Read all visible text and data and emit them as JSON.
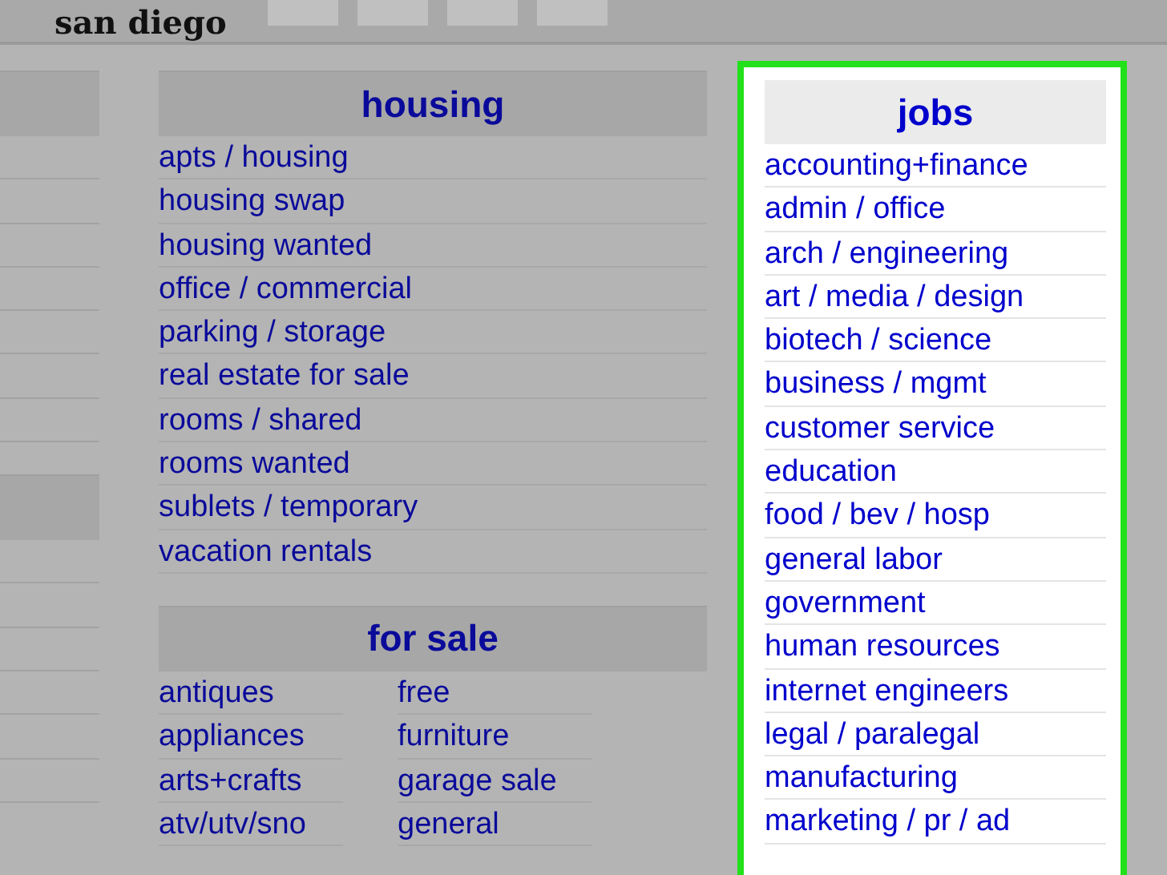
{
  "site_title": "san diego",
  "housing": {
    "title": "housing",
    "links": [
      "apts / housing",
      "housing swap",
      "housing wanted",
      "office / commercial",
      "parking / storage",
      "real estate for sale",
      "rooms / shared",
      "rooms wanted",
      "sublets / temporary",
      "vacation rentals"
    ]
  },
  "for_sale": {
    "title": "for sale",
    "links": [
      "antiques",
      "free",
      "appliances",
      "furniture",
      "arts+crafts",
      "garage sale",
      "atv/utv/sno",
      "general"
    ]
  },
  "jobs": {
    "title": "jobs",
    "highlighted": true,
    "links": [
      "accounting+finance",
      "admin / office",
      "arch / engineering",
      "art / media / design",
      "biotech / science",
      "business / mgmt",
      "customer service",
      "education",
      "food / bev / hosp",
      "general labor",
      "government",
      "human resources",
      "internet engineers",
      "legal / paralegal",
      "manufacturing",
      "marketing / pr / ad"
    ]
  }
}
